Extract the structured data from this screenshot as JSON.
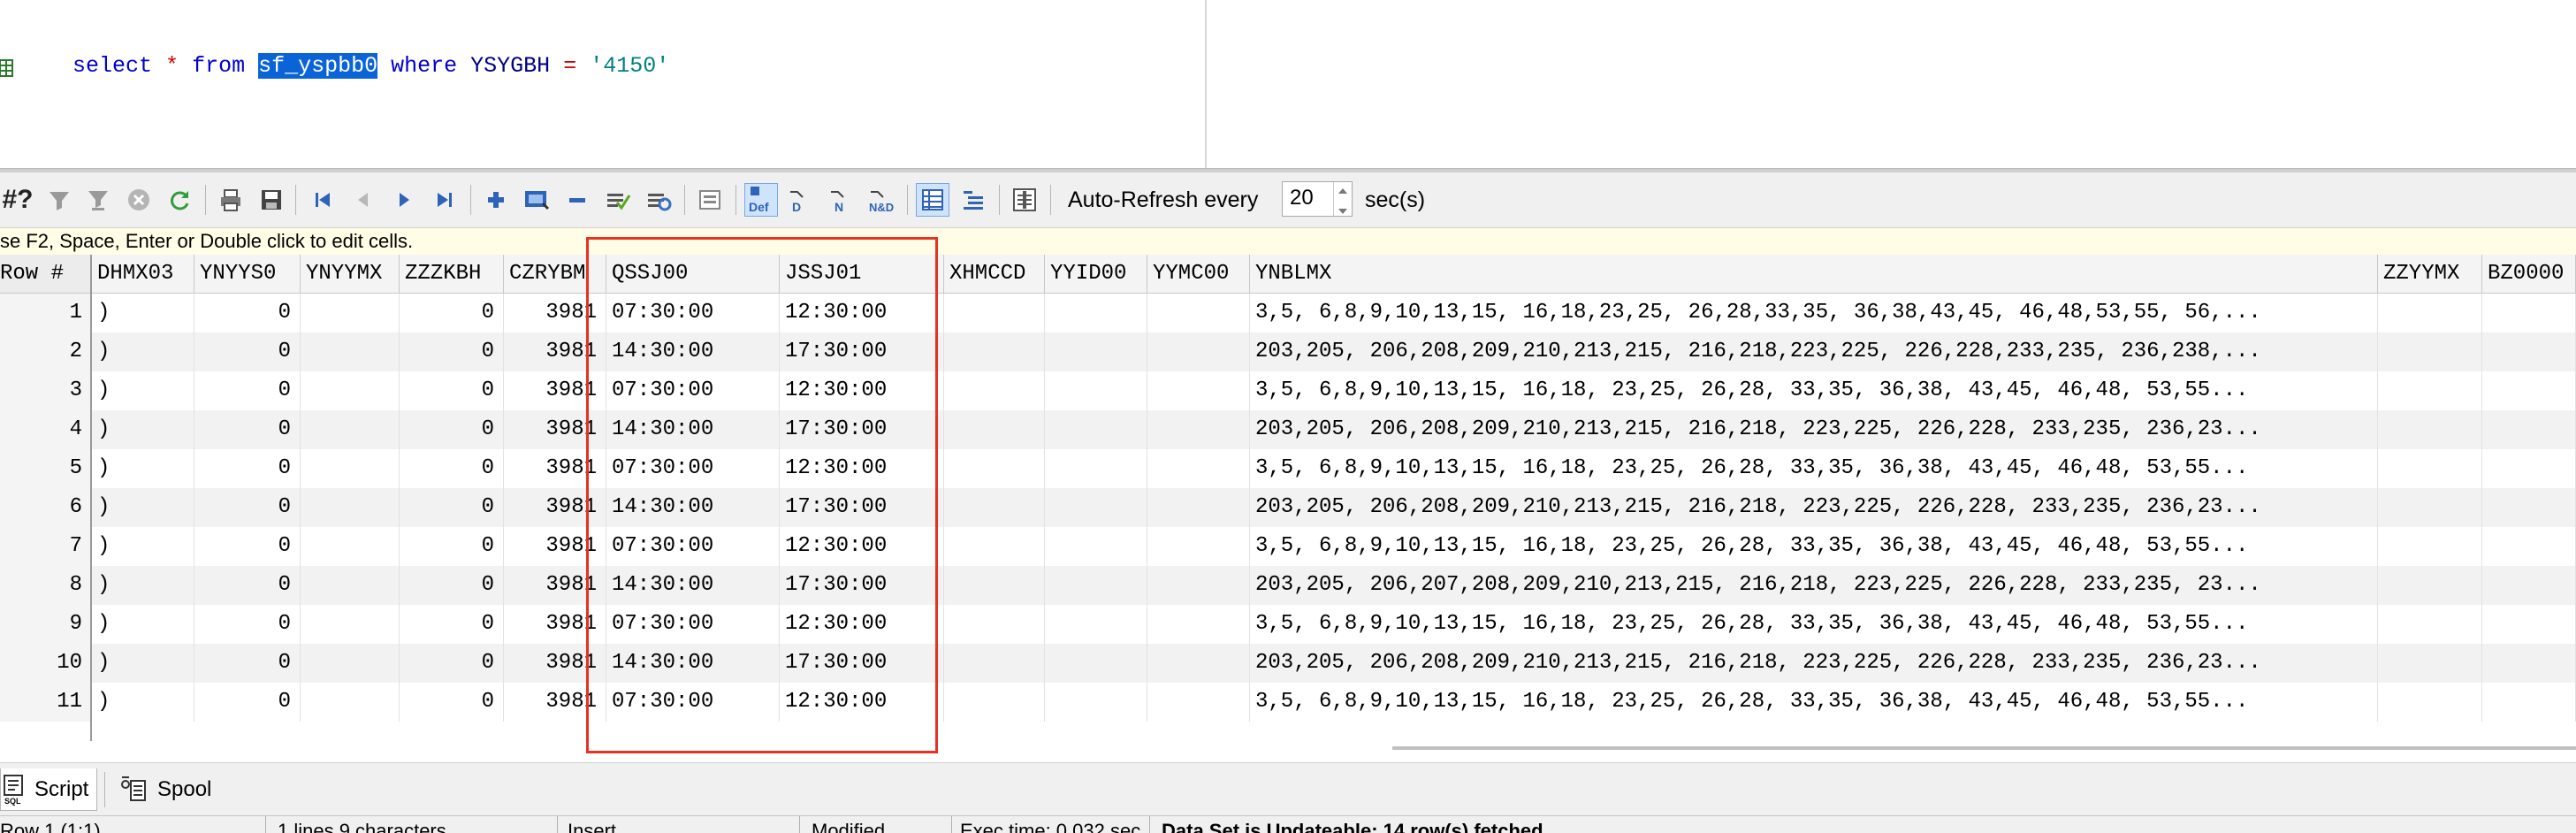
{
  "editor": {
    "sql": {
      "kw_select": "select",
      "star": "*",
      "kw_from": "from",
      "table": "sf_yspbb0",
      "kw_where": "where",
      "column": "YSYGBH",
      "equals": "=",
      "value": "'4150'"
    }
  },
  "toolbar": {
    "hash_label": "#?",
    "auto_refresh_label": "Auto-Refresh every",
    "auto_refresh_value": "20",
    "auto_refresh_unit": "sec(s)",
    "def_label": "Def",
    "d_label": "D",
    "n_label": "N",
    "nd_label": "N&D"
  },
  "hint": "se F2, Space, Enter or Double click to edit cells.",
  "grid": {
    "columns": [
      "Row #",
      "DHMX03",
      "YNYYS0",
      "YNYYMX",
      "ZZZKBH",
      "CZRYBM",
      "QSSJ00",
      "JSSJ01",
      "XHMCCD",
      "YYID00",
      "YYMC00",
      "YNBLMX",
      "ZZYYMX",
      "BZ0000"
    ],
    "rows": [
      {
        "n": "1",
        "d": ")",
        "y": "0",
        "c": "3981",
        "q": "07:30:00",
        "j": "12:30:00",
        "b": "3,5, 6,8,9,10,13,15, 16,18,23,25, 26,28,33,35, 36,38,43,45, 46,48,53,55, 56,..."
      },
      {
        "n": "2",
        "d": ")",
        "y": "0",
        "c": "3981",
        "q": "14:30:00",
        "j": "17:30:00",
        "b": "203,205, 206,208,209,210,213,215, 216,218,223,225, 226,228,233,235, 236,238,..."
      },
      {
        "n": "3",
        "d": ")",
        "y": "0",
        "c": "3981",
        "q": "07:30:00",
        "j": "12:30:00",
        "b": "3,5, 6,8,9,10,13,15, 16,18, 23,25, 26,28, 33,35, 36,38, 43,45, 46,48, 53,55..."
      },
      {
        "n": "4",
        "d": ")",
        "y": "0",
        "c": "3981",
        "q": "14:30:00",
        "j": "17:30:00",
        "b": "203,205, 206,208,209,210,213,215, 216,218, 223,225, 226,228, 233,235, 236,23..."
      },
      {
        "n": "5",
        "d": ")",
        "y": "0",
        "c": "3981",
        "q": "07:30:00",
        "j": "12:30:00",
        "b": "3,5, 6,8,9,10,13,15, 16,18, 23,25, 26,28, 33,35, 36,38, 43,45, 46,48, 53,55..."
      },
      {
        "n": "6",
        "d": ")",
        "y": "0",
        "c": "3981",
        "q": "14:30:00",
        "j": "17:30:00",
        "b": "203,205, 206,208,209,210,213,215, 216,218, 223,225, 226,228, 233,235, 236,23..."
      },
      {
        "n": "7",
        "d": ")",
        "y": "0",
        "c": "3981",
        "q": "07:30:00",
        "j": "12:30:00",
        "b": "3,5, 6,8,9,10,13,15, 16,18, 23,25, 26,28, 33,35, 36,38, 43,45, 46,48, 53,55..."
      },
      {
        "n": "8",
        "d": ")",
        "y": "0",
        "c": "3981",
        "q": "14:30:00",
        "j": "17:30:00",
        "b": "203,205, 206,207,208,209,210,213,215, 216,218, 223,225, 226,228, 233,235, 23..."
      },
      {
        "n": "9",
        "d": ")",
        "y": "0",
        "c": "3981",
        "q": "07:30:00",
        "j": "12:30:00",
        "b": "3,5, 6,8,9,10,13,15, 16,18, 23,25, 26,28, 33,35, 36,38, 43,45, 46,48, 53,55..."
      },
      {
        "n": "10",
        "d": ")",
        "y": "0",
        "c": "3981",
        "q": "14:30:00",
        "j": "17:30:00",
        "b": "203,205, 206,208,209,210,213,215, 216,218, 223,225, 226,228, 233,235, 236,23..."
      },
      {
        "n": "11",
        "d": ")",
        "y": "0",
        "c": "3981",
        "q": "07:30:00",
        "j": "12:30:00",
        "b": "3,5, 6,8,9,10,13,15, 16,18, 23,25, 26,28, 33,35, 36,38, 43,45, 46,48, 53,55..."
      }
    ]
  },
  "tabs": {
    "script": "Script",
    "spool": "Spool"
  },
  "status": {
    "position": "Row 1 (1:1)",
    "lines": "1 lines 9 characters",
    "mode": "Insert",
    "modified": "Modified",
    "exec_time": "Exec time: 0.032 sec",
    "message": "Data Set is Updateable: 14 row(s) fetched"
  },
  "colors": {
    "highlight_box": "#e53222",
    "selection": "#0a64d8",
    "keyword": "#0000cc",
    "string": "#008080"
  }
}
